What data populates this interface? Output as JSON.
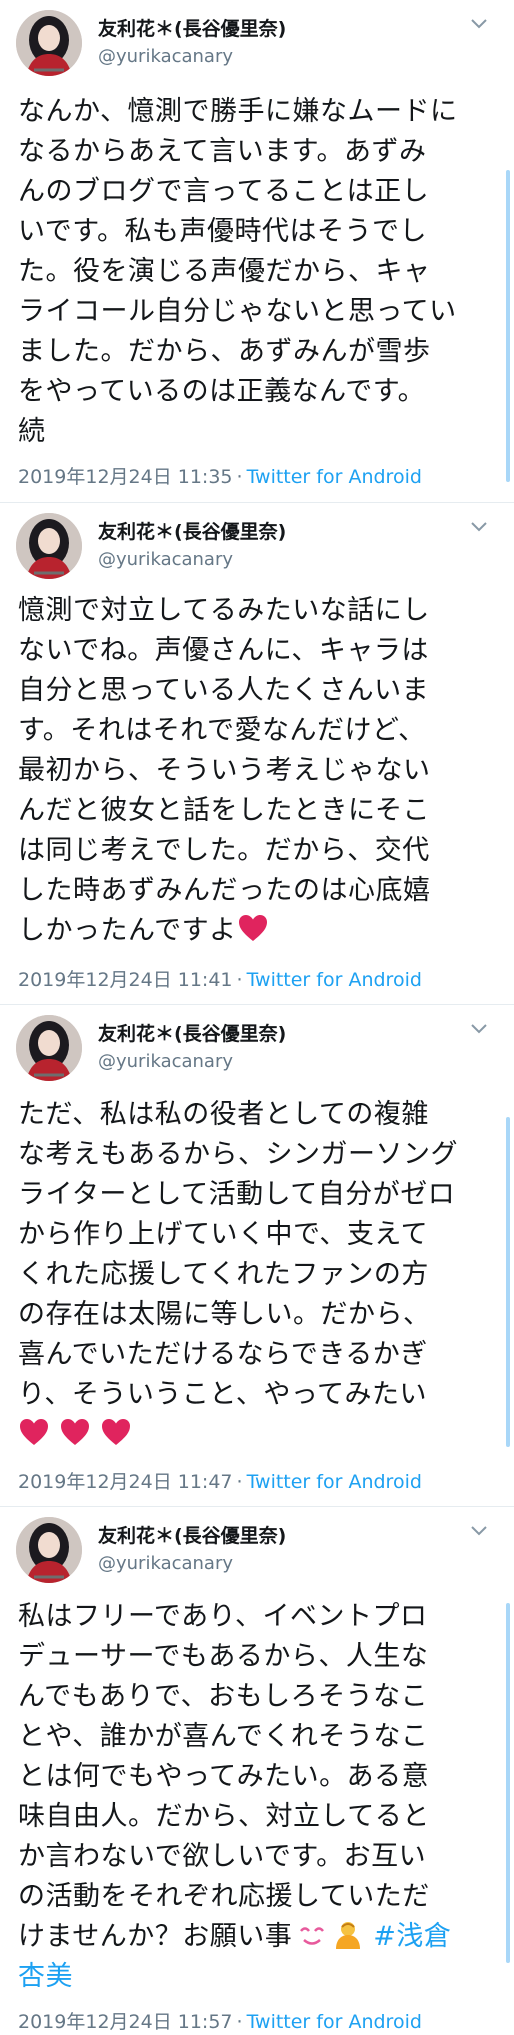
{
  "colors": {
    "link": "#1da1f2",
    "secondary_text": "#657786",
    "primary_text": "#14171a",
    "thread_line": "#a9d7f8",
    "heart": "#e0245e",
    "divider": "#e6ecf0"
  },
  "tweets": [
    {
      "author": {
        "name": "友利花＊(長谷優里奈)",
        "handle": "@yurikacanary"
      },
      "lines": [
        "なんか、憶測で勝手に嫌なムードに",
        "なるからあえて言います。あずみ",
        "んのブログで言ってることは正し",
        "いです。私も声優時代はそうでし",
        "た。役を演じる声優だから、キャ",
        "ライコール自分じゃないと思ってい",
        "ました。だから、あずみんが雪歩",
        "をやっているのは正義なんです。",
        "続"
      ],
      "timestamp": "2019年12月24日 11:35",
      "separator": "·",
      "source": "Twitter for Android"
    },
    {
      "author": {
        "name": "友利花＊(長谷優里奈)",
        "handle": "@yurikacanary"
      },
      "lines": [
        "憶測で対立してるみたいな話にし",
        "ないでね。声優さんに、キャラは",
        "自分と思っている人たくさんいま",
        "す。それはそれで愛なんだけど、",
        "最初から、そういう考えじゃない",
        "んだと彼女と話をしたときにそこ",
        "は同じ考えでした。だから、交代",
        "した時あずみんだったのは心底嬉",
        "しかったんですよ"
      ],
      "timestamp": "2019年12月24日 11:41",
      "separator": "·",
      "source": "Twitter for Android"
    },
    {
      "author": {
        "name": "友利花＊(長谷優里奈)",
        "handle": "@yurikacanary"
      },
      "lines": [
        "ただ、私は私の役者としての複雑",
        "な考えもあるから、シンガーソング",
        "ライターとして活動して自分がゼロ",
        "から作り上げていく中で、支えて",
        "くれた応援してくれたファンの方",
        "の存在は太陽に等しい。だから、",
        "喜んでいただけるならできるかぎ",
        "り、そういうこと、やってみたい"
      ],
      "timestamp": "2019年12月24日 11:47",
      "separator": "·",
      "source": "Twitter for Android"
    },
    {
      "author": {
        "name": "友利花＊(長谷優里奈)",
        "handle": "@yurikacanary"
      },
      "lines": [
        "私はフリーであり、イベントプロ",
        "デューサーでもあるから、人生な",
        "んでもありで、おもしろそうなこ",
        "とや、誰かが喜んでくれそうなこ",
        "とは何でもやってみたい。ある意",
        "味自由人。だから、対立してると",
        "か言わないで欲しいです。お互い",
        "の活動をそれぞれ応援していただ",
        "けませんか？お願い事"
      ],
      "hashtag_part1": "#浅倉",
      "hashtag_part2": "杏美",
      "timestamp": "2019年12月24日 11:57",
      "separator": "·",
      "source": "Twitter for Android"
    }
  ]
}
